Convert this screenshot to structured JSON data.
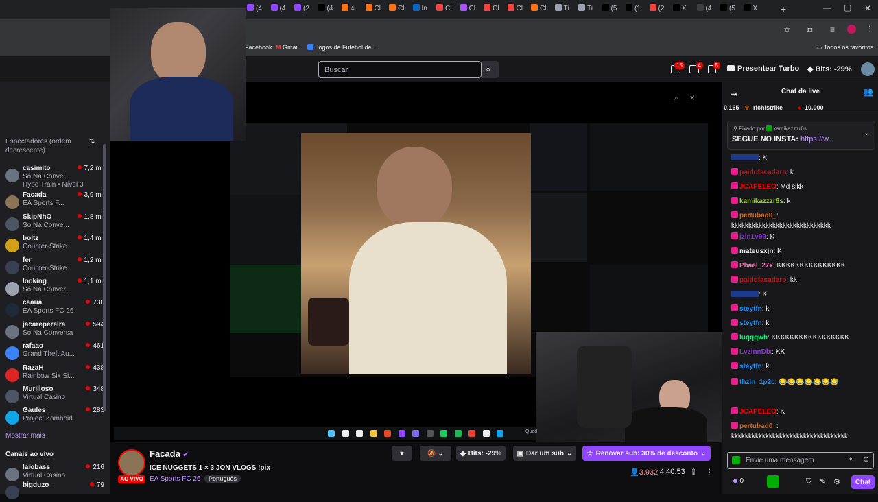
{
  "browser": {
    "tabs": [
      {
        "label": "(4",
        "color": "#9146ff"
      },
      {
        "label": "(4",
        "color": "#9146ff"
      },
      {
        "label": "(2",
        "color": "#9146ff"
      },
      {
        "label": "(4",
        "color": "#000000"
      },
      {
        "label": "4",
        "color": "#f97316"
      },
      {
        "label": "Cl",
        "color": "#f97316"
      },
      {
        "label": "Cl",
        "color": "#f97316"
      },
      {
        "label": "In",
        "color": "#0a66c2"
      },
      {
        "label": "Cl",
        "color": "#ef4444"
      },
      {
        "label": "Cl",
        "color": "#a855f7"
      },
      {
        "label": "Cl",
        "color": "#ef4444"
      },
      {
        "label": "Cl",
        "color": "#ef4444"
      },
      {
        "label": "Cl",
        "color": "#f97316"
      },
      {
        "label": "Ti",
        "color": "#9ca3af"
      },
      {
        "label": "Ti",
        "color": "#9ca3af"
      },
      {
        "label": "(5",
        "color": "#000000"
      },
      {
        "label": "(1",
        "color": "#000000"
      },
      {
        "label": "(2",
        "color": "#ef4444"
      },
      {
        "label": "X",
        "color": "#000000"
      },
      {
        "label": "(4",
        "color": "#3c4043"
      },
      {
        "label": "(5",
        "color": "#000000"
      },
      {
        "label": "X",
        "color": "#000000"
      }
    ],
    "bookmarks": [
      "Facebook",
      "Gmail",
      "Jogos de Futebol de...",
      "Todos os favoritos"
    ]
  },
  "header": {
    "search_placeholder": "Buscar",
    "notif_counts": [
      "15",
      "4",
      "5"
    ],
    "turbo_label": "Presentear Turbo",
    "bits_label": "Bits: -29%"
  },
  "sidebar": {
    "section_label": "Espectadores (ordem decrescente)",
    "channels": [
      {
        "name": "casimito",
        "game": "Só Na Conve...",
        "extra": "Hype Train • Nível 3",
        "viewers": "7,2 mil",
        "color": "#6b7280"
      },
      {
        "name": "Facada",
        "game": "EA Sports F...",
        "viewers": "3,9 mil",
        "color": "#8b7355"
      },
      {
        "name": "SkipNhO",
        "game": "Só Na Conve...",
        "viewers": "1,8 mil",
        "color": "#4b5563"
      },
      {
        "name": "boltz",
        "game": "Counter-Strike",
        "viewers": "1,4 mil",
        "color": "#d4a017"
      },
      {
        "name": "fer",
        "game": "Counter-Strike",
        "viewers": "1,2 mil",
        "color": "#374151"
      },
      {
        "name": "locking",
        "game": "Só Na Conver...",
        "viewers": "1,1 mil",
        "color": "#9ca3af"
      },
      {
        "name": "caaua",
        "game": "EA Sports FC 26",
        "viewers": "738",
        "color": "#1f2937"
      },
      {
        "name": "jacarepereira",
        "game": "Só Na Conversa",
        "viewers": "594",
        "color": "#6b7280"
      },
      {
        "name": "rafaao",
        "game": "Grand Theft Au...",
        "viewers": "461",
        "color": "#3b82f6"
      },
      {
        "name": "RazaH",
        "game": "Rainbow Six Si...",
        "viewers": "438",
        "color": "#dc2626"
      },
      {
        "name": "Murilloso",
        "game": "Virtual Casino",
        "viewers": "348",
        "color": "#4b5563"
      },
      {
        "name": "Gaules",
        "game": "Project Zomboid",
        "viewers": "283",
        "color": "#0ea5e9"
      }
    ],
    "show_more": "Mostrar mais",
    "live_section": "Canais ao vivo",
    "live_channels": [
      {
        "name": "laiobass",
        "game": "Virtual Casino",
        "viewers": "216",
        "color": "#6b7280"
      },
      {
        "name": "bigduzo_",
        "game": "",
        "viewers": "79",
        "color": "#374151"
      }
    ]
  },
  "player": {
    "taskbar_clock": "Quad"
  },
  "stream": {
    "channel": "Facada",
    "title": "ICE NUGGETS 1 × 3 JON VLOGS !pix",
    "live_badge": "AO VIVO",
    "game": "EA Sports FC 26",
    "tag": "Português",
    "bits_label": "Bits: -29%",
    "sub_label": "Dar um sub",
    "renew_label": "Renovar sub: 30% de desconto",
    "viewers": "3.932",
    "uptime": "4:40:53"
  },
  "chat": {
    "title": "Chat da live",
    "leader_value": "0.165",
    "leader_name": "richistrike",
    "leader_bits": "10.000",
    "pinned_by": "Fixado por",
    "pinned_user": "kamikazzzr6s",
    "pinned_text": "SEGUE NO INSTA:",
    "pinned_link": "https://w...",
    "messages": [
      {
        "user": "",
        "color": "#1e3a8a",
        "text": ": K"
      },
      {
        "user": "paidofacadarp",
        "color": "#b91c1c",
        "text": ": k"
      },
      {
        "user": "JCAPELEO",
        "color": "#ff0000",
        "text": ": Md sikk"
      },
      {
        "user": "kamikazzzr6s",
        "color": "#9acd32",
        "text": ": k"
      },
      {
        "user": "pertubad0_",
        "color": "#d2691e",
        "text": ":"
      },
      {
        "user": "",
        "color": "#efeff1",
        "text": "kkkkkkkkkkkkkkkkkkkkkkkkkkkkk"
      },
      {
        "user": "jzin1v99",
        "color": "#8a2be2",
        "text": ": K"
      },
      {
        "user": "mateusxjn",
        "color": "#efeff1",
        "text": ": K"
      },
      {
        "user": "Phael_27x",
        "color": "#ff69b4",
        "text": ": KKKKKKKKKKKKKKK"
      },
      {
        "user": "paidofacadarp",
        "color": "#b91c1c",
        "text": ": kk"
      },
      {
        "user": "",
        "color": "#1e3a8a",
        "text": ": K"
      },
      {
        "user": "steytfn",
        "color": "#1e90ff",
        "text": ": k"
      },
      {
        "user": "steytfn",
        "color": "#1e90ff",
        "text": ": k"
      },
      {
        "user": "luqqqwh",
        "color": "#00ff7f",
        "text": ": KKKKKKKKKKKKKKKKK"
      },
      {
        "user": "LvzinnDlx",
        "color": "#8a2be2",
        "text": ": KK"
      },
      {
        "user": "steytfn",
        "color": "#1e90ff",
        "text": ": k"
      },
      {
        "user": "thzin_1p2c",
        "color": "#1e90ff",
        "text": ": 😂😂😂😂😂😂😂"
      },
      {
        "user": "JCAPELEO",
        "color": "#ff0000",
        "text": ": K"
      },
      {
        "user": "pertubad0_",
        "color": "#d2691e",
        "text": ":"
      },
      {
        "user": "",
        "color": "#efeff1",
        "text": "kkkkkkkkkkkkkkkkkkkkkkkkkkkkkkkkkk"
      }
    ],
    "input_placeholder": "Envie uma mensagem",
    "points": "0",
    "chat_button": "Chat"
  }
}
